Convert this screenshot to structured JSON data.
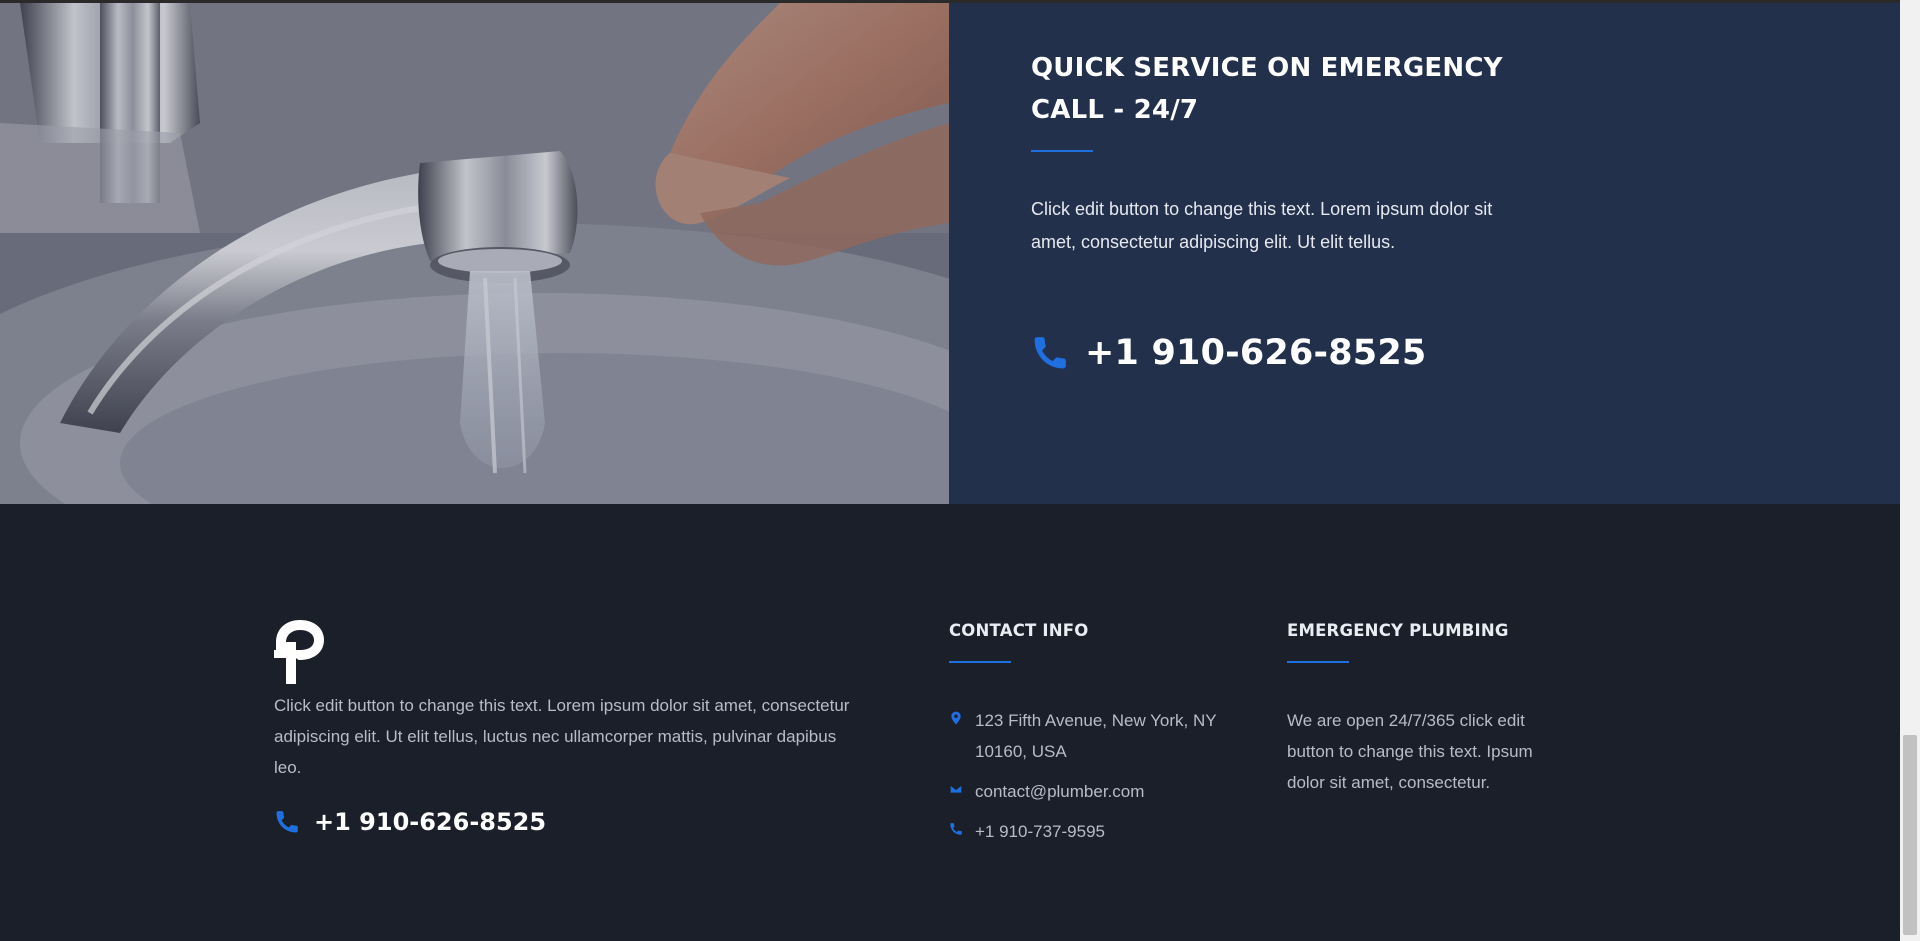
{
  "hero": {
    "image_alt": "Hand near a chrome faucet with running water",
    "title": "QUICK SERVICE ON EMERGENCY CALL - 24/7",
    "text": "Click edit button to change this text. Lorem ipsum dolor sit amet, consectetur adipiscing elit. Ut elit tellus.",
    "phone": "+1 910-626-8525",
    "phone_icon": "phone-icon"
  },
  "footer": {
    "logo_icon": "logo-p-icon",
    "about_text": "Click edit button to change this text. Lorem ipsum dolor sit amet, consectetur adipiscing elit. Ut elit tellus, luctus nec ullamcorper mattis, pulvinar dapibus leo.",
    "phone": "+1 910-626-8525",
    "contact": {
      "heading": "CONTACT INFO",
      "items": [
        {
          "icon": "location-pin-icon",
          "text": "123 Fifth Avenue, New York, NY 10160, USA"
        },
        {
          "icon": "envelope-icon",
          "text": "contact@plumber.com"
        },
        {
          "icon": "phone-icon",
          "text": "+1 910-737-9595"
        }
      ]
    },
    "emergency": {
      "heading": "EMERGENCY PLUMBING",
      "text": "We are open 24/7/365 click edit button to change this text. Ipsum dolor sit amet, consectetur."
    }
  },
  "colors": {
    "accent": "#1f6fe0",
    "hero_panel": "#22304b",
    "footer_bg": "#1b1f29",
    "heading": "#ffffff",
    "body_text": "#b8bcc6"
  }
}
